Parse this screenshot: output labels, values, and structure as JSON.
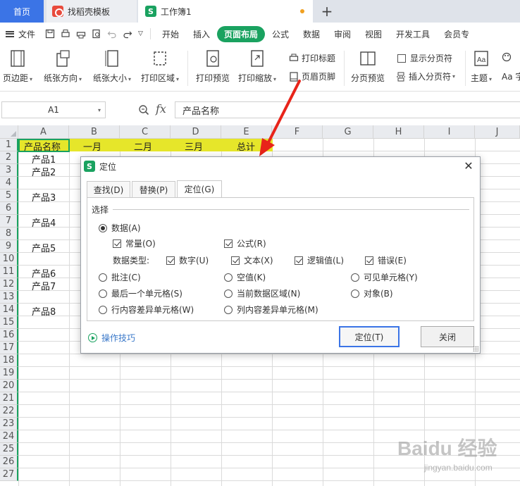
{
  "tabs": {
    "home": "首页",
    "templates": "找稻壳模板",
    "workbook": "工作簿1",
    "add": "+"
  },
  "menubar": {
    "file": "文件",
    "items": [
      "开始",
      "插入",
      "页面布局",
      "公式",
      "数据",
      "审阅",
      "视图",
      "开发工具",
      "会员专"
    ],
    "active_index": 2
  },
  "ribbon": {
    "margins": "页边距",
    "orientation": "纸张方向",
    "size": "纸张大小",
    "print_area": "打印区域",
    "print_preview": "打印预览",
    "print_scale": "打印缩放",
    "print_titles": "打印标题",
    "header_footer": "页眉页脚",
    "page_break_preview": "分页预览",
    "show_page_breaks": "显示分页符",
    "insert_page_break": "插入分页符",
    "theme": "主题",
    "more": "Aa 字"
  },
  "formula_bar": {
    "cell_ref": "A1",
    "fx": "fx",
    "content": "产品名称"
  },
  "sheet": {
    "columns": [
      "A",
      "B",
      "C",
      "D",
      "E",
      "F",
      "G",
      "H",
      "I",
      "J"
    ],
    "rows": [
      "1",
      "2",
      "3",
      "4",
      "5",
      "6",
      "7",
      "8",
      "9",
      "10",
      "11",
      "12",
      "13",
      "14",
      "15",
      "16",
      "17",
      "18",
      "19",
      "20",
      "21",
      "22",
      "23",
      "24",
      "25",
      "26",
      "27"
    ],
    "header_row": [
      "产品名称",
      "一月",
      "二月",
      "三月",
      "总计"
    ],
    "products": [
      {
        "row": 2,
        "name": "产品1"
      },
      {
        "row": 3,
        "name": "产品2"
      },
      {
        "row": 5,
        "name": "产品3"
      },
      {
        "row": 7,
        "name": "产品4"
      },
      {
        "row": 9,
        "name": "产品5"
      },
      {
        "row": 11,
        "name": "产品6"
      },
      {
        "row": 12,
        "name": "产品7"
      },
      {
        "row": 14,
        "name": "产品8"
      }
    ],
    "highlight_color": "#e6e62a"
  },
  "dialog": {
    "title": "定位",
    "tabs": [
      "查找(D)",
      "替换(P)",
      "定位(G)"
    ],
    "active_tab": 2,
    "section": "选择",
    "options": {
      "data": "数据(A)",
      "constants": "常量(O)",
      "formulas": "公式(R)",
      "data_type_label": "数据类型:",
      "number": "数字(U)",
      "text": "文本(X)",
      "logical": "逻辑值(L)",
      "error": "错误(E)",
      "comments": "批注(C)",
      "blanks": "空值(K)",
      "visible_cells": "可见单元格(Y)",
      "last_cell": "最后一个单元格(S)",
      "current_region": "当前数据区域(N)",
      "objects": "对象(B)",
      "row_differences": "行内容差异单元格(W)",
      "column_differences": "列内容差异单元格(M)"
    },
    "tips": "操作技巧",
    "ok": "定位(T)",
    "close": "关闭"
  },
  "watermark": {
    "brand": "Baidu 经验",
    "url": "jingyan.baidu.com"
  },
  "colors": {
    "accent_green": "#1aa260",
    "tab_blue": "#3b74e6",
    "arrow_red": "#e8241a"
  }
}
